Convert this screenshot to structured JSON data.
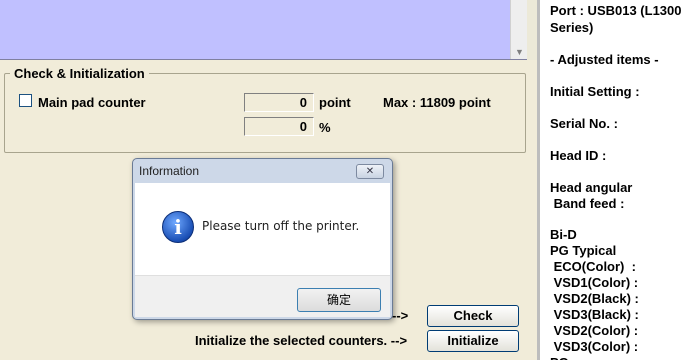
{
  "check_group": {
    "title": "Check & Initialization",
    "main_pad_label": "Main pad counter",
    "point_value": "0",
    "point_unit": "point",
    "max_text": "Max : 11809 point",
    "percent_value": "0",
    "percent_unit": "%"
  },
  "actions": {
    "check_arrow": "-->",
    "initialize_text": "Initialize the selected counters. -->",
    "check_button": "Check",
    "initialize_button": "Initialize"
  },
  "right_panel": {
    "port_line1": "Port : USB013 (L1300",
    "port_line2": "Series)",
    "adjusted": "- Adjusted items -",
    "initial_setting": "Initial Setting :",
    "serial": "Serial No. :",
    "head_id": "Head ID :",
    "head_angular": "Head angular",
    "band_feed": " Band feed :",
    "bi_d": "Bi-D",
    "pg_typical": "PG Typical",
    "eco": " ECO(Color)  :",
    "vsd1": " VSD1(Color) :",
    "vsd2b": " VSD2(Black) :",
    "vsd3b": " VSD3(Black) :",
    "vsd2c": " VSD2(Color) :",
    "vsd3c": " VSD3(Color) :",
    "pg_cut": "PG"
  },
  "dialog": {
    "title": "Information",
    "close_glyph": "✕",
    "icon_glyph": "i",
    "message": "Please turn off the printer.",
    "ok_label": "确定"
  },
  "icons": {
    "info": "info-icon",
    "close": "close-icon",
    "scroll_down": "scroll-down-arrow-icon"
  }
}
